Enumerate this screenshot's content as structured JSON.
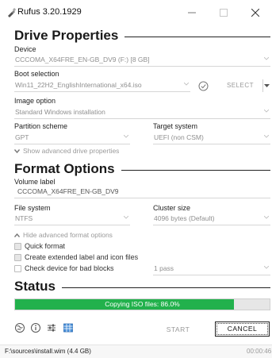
{
  "window": {
    "title": "Rufus 3.20.1929",
    "icons": {
      "app": "usb-drive-icon",
      "minimize": "minimize-icon",
      "maximize": "maximize-icon",
      "close": "close-icon"
    }
  },
  "drive_properties": {
    "title": "Drive Properties",
    "device_label": "Device",
    "device_value": "CCCOMA_X64FRE_EN-GB_DV9 (F:) [8 GB]",
    "boot_selection_label": "Boot selection",
    "boot_selection_value": "Win11_22H2_EnglishInternational_x64.iso",
    "select_button": "SELECT",
    "image_option_label": "Image option",
    "image_option_value": "Standard Windows installation",
    "partition_scheme_label": "Partition scheme",
    "partition_scheme_value": "GPT",
    "target_system_label": "Target system",
    "target_system_value": "UEFI (non CSM)",
    "advanced_toggle": "Show advanced drive properties"
  },
  "format_options": {
    "title": "Format Options",
    "volume_label_label": "Volume label",
    "volume_label_value": "CCCOMA_X64FRE_EN-GB_DV9",
    "file_system_label": "File system",
    "file_system_value": "NTFS",
    "cluster_size_label": "Cluster size",
    "cluster_size_value": "4096 bytes (Default)",
    "advanced_toggle": "Hide advanced format options",
    "quick_format": "Quick format",
    "extended_label": "Create extended label and icon files",
    "bad_blocks": "Check device for bad blocks",
    "passes_value": "1 pass"
  },
  "status": {
    "title": "Status",
    "progress_text": "Copying ISO files: 86.0%",
    "progress_fraction": 0.86,
    "start_button": "START",
    "cancel_button": "CANCEL",
    "footer_path": "F:\\sources\\install.wim (4.4 GB)",
    "footer_timer": "00:00:46"
  },
  "colors": {
    "progress_fill": "#22b14c",
    "progress_track": "#e6e6e6"
  }
}
